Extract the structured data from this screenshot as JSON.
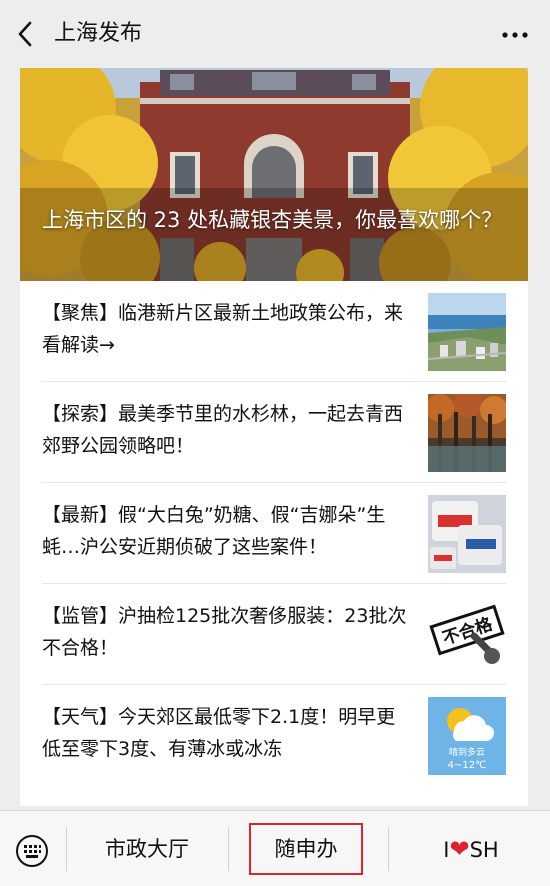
{
  "header": {
    "title": "上海发布"
  },
  "hero": {
    "title": "上海市区的 23 处私藏银杏美景，你最喜欢哪个？"
  },
  "articles": [
    {
      "text": "【聚焦】临港新片区最新土地政策公布，来看解读→",
      "thumb": "aerial-city-thumbnail"
    },
    {
      "text": "【探索】最美季节里的水杉林，一起去青西郊野公园领略吧！",
      "thumb": "metasequoia-forest-thumbnail"
    },
    {
      "text": "【最新】假“大白兔”奶糖、假“吉娜朵”生蚝…沪公安近期侦破了这些案件！",
      "thumb": "white-rabbit-candy-thumbnail"
    },
    {
      "text": "【监管】沪抽检125批次奢侈服装：23批次不合格！",
      "thumb": "unqualified-stamp-thumbnail"
    },
    {
      "text": "【天气】今天郊区最低零下2.1度！明早更低至零下3度、有薄冰或冰冻",
      "thumb": "weather-thumbnail"
    }
  ],
  "thumbs": {
    "stamp_text": "不合格",
    "weather_desc": "晴到多云",
    "weather_temp": "4~12℃"
  },
  "bottom_menu": {
    "item1": "市政大厅",
    "item2": "随申办",
    "item3_prefix": "I",
    "item3_heart": "❤",
    "item3_suffix": "SH"
  },
  "colors": {
    "highlight_border": "#d9262b",
    "heart": "#e0202a"
  }
}
